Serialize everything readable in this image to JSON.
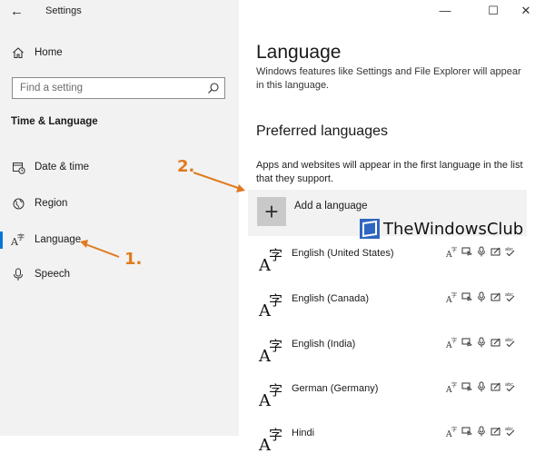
{
  "window": {
    "title": "Settings",
    "back_glyph": "←",
    "min_glyph": "—",
    "max_glyph": "☐",
    "close_glyph": "✕"
  },
  "sidebar": {
    "home": {
      "label": "Home",
      "icon": "home-icon"
    },
    "search_placeholder": "Find a setting",
    "section": "Time & Language",
    "items": [
      {
        "label": "Date & time",
        "icon": "calendar-clock-icon",
        "active": false
      },
      {
        "label": "Region",
        "icon": "globe-icon",
        "active": false
      },
      {
        "label": "Language",
        "icon": "language-icon",
        "active": true
      },
      {
        "label": "Speech",
        "icon": "microphone-icon",
        "active": false
      }
    ]
  },
  "main": {
    "title": "Language",
    "desc": "Windows features like Settings and File Explorer will appear in this language.",
    "preferred_heading": "Preferred languages",
    "preferred_desc": "Apps and websites will appear in the first language in the list that they support.",
    "add_language": "Add a language",
    "languages": [
      {
        "name": "English (United States)"
      },
      {
        "name": "English (Canada)"
      },
      {
        "name": "English (India)"
      },
      {
        "name": "German (Germany)"
      },
      {
        "name": "Hindi"
      }
    ],
    "feature_icons": [
      "display-language-icon",
      "speech-icon",
      "microphone-icon",
      "handwriting-icon",
      "spelling-icon"
    ]
  },
  "annotations": {
    "step1": "1.",
    "step2": "2.",
    "arrow_color": "#e07b1f"
  },
  "watermark": "TheWindowsClub",
  "colors": {
    "accent": "#0078d7",
    "sidebar_bg": "#f2f2f2",
    "add_row_bg": "#f2f2f2"
  }
}
